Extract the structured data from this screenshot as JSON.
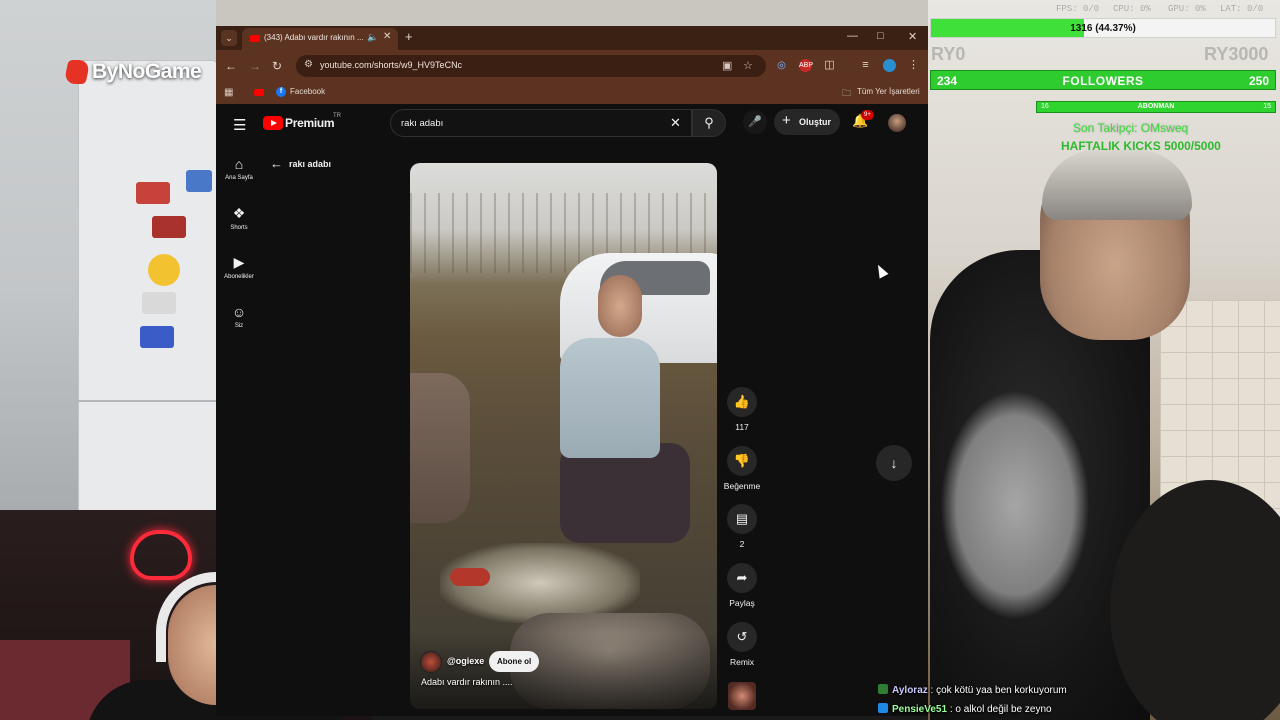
{
  "overlay": {
    "logo_text": "ByNoGame",
    "sub_goal": {
      "text": "1316 (44.37%)",
      "progress": 0.4437
    },
    "faded_counters": [
      "FPS: 0/0",
      "CPU: 0%",
      "GPU: 0%",
      "LAT: 0/0"
    ],
    "faded_left": "RY0",
    "faded_right": "RY3000",
    "followers": {
      "start": "234",
      "label": "FOLLOWERS",
      "end": "250",
      "progress": 0.0
    },
    "abonman": {
      "start": "16",
      "label": "ABONMAN",
      "end": "15"
    },
    "last_follower": "Son Takipçi: OMsweq",
    "weekly_kicks": "HAFTALIK KICKS 5000/5000",
    "chat": [
      {
        "user": "Ayloraz",
        "message": ": çok kötü yaa ben korkuyorum",
        "badge_color": "#2e7d32"
      },
      {
        "user": "PensieVe51",
        "message": ": o alkol değil be zeyno",
        "badge_color": "#1e88e5"
      }
    ]
  },
  "browser": {
    "tab_title": "(343) Adabı vardır rakının ...",
    "tab_audio_icon": "speaker-icon",
    "url": "youtube.com/shorts/w9_HV9TeCNc",
    "bookmarks": {
      "facebook": "Facebook",
      "all_bookmarks": "Tüm Yer İşaretleri"
    },
    "window_controls": [
      "minimize",
      "maximize",
      "close"
    ]
  },
  "youtube": {
    "brand": "Premium",
    "region": "TR",
    "search_value": "rakı adabı",
    "create_label": "Oluştur",
    "notification_badge": "9+",
    "sidebar": [
      {
        "label": "Ana Sayfa",
        "icon": "home-icon"
      },
      {
        "label": "Shorts",
        "icon": "shorts-icon"
      },
      {
        "label": "Abonelikler",
        "icon": "subscriptions-icon"
      },
      {
        "label": "Siz",
        "icon": "you-icon"
      }
    ],
    "back_label": "rakı adabı",
    "short": {
      "channel": "@ogiexe",
      "subscribe_label": "Abone ol",
      "title": "Adabı vardır rakının ...."
    },
    "actions": {
      "likes": "117",
      "dislike_label": "Beğenme",
      "comments": "2",
      "share_label": "Paylaş",
      "remix_label": "Remix"
    }
  }
}
